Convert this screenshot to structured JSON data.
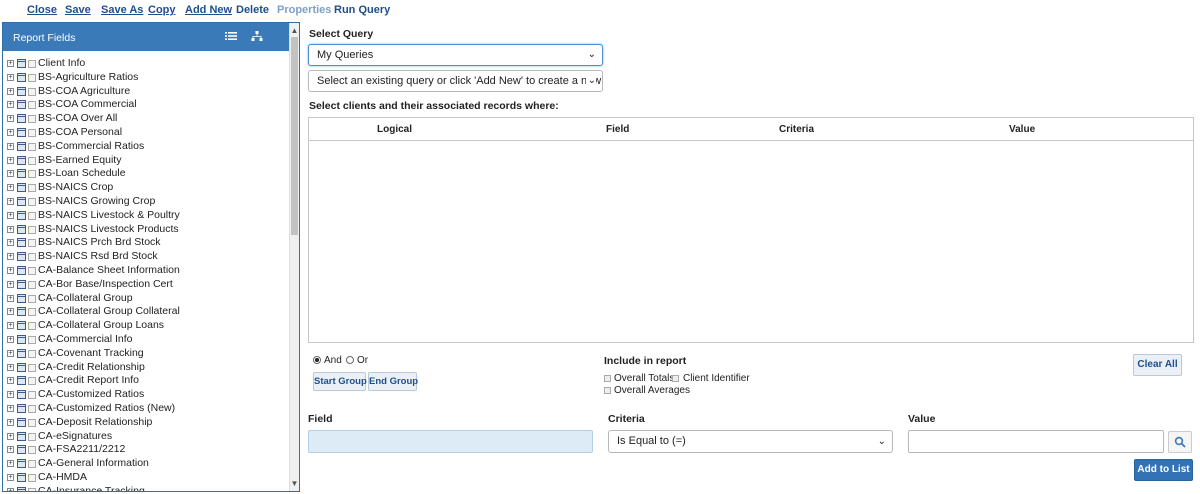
{
  "menu": {
    "close": "Close",
    "save": "Save",
    "save_as": "Save As",
    "copy": "Copy",
    "add_new": "Add New",
    "delete": "Delete",
    "properties": "Properties",
    "run_query": "Run Query"
  },
  "left_panel": {
    "title": "Report Fields",
    "icons": [
      "list-view-icon",
      "hierarchy-view-icon"
    ],
    "tree_items": [
      "Client Info",
      "BS-Agriculture Ratios",
      "BS-COA Agriculture",
      "BS-COA Commercial",
      "BS-COA Over All",
      "BS-COA Personal",
      "BS-Commercial Ratios",
      "BS-Earned Equity",
      "BS-Loan Schedule",
      "BS-NAICS Crop",
      "BS-NAICS Growing Crop",
      "BS-NAICS Livestock & Poultry",
      "BS-NAICS Livestock Products",
      "BS-NAICS Prch Brd Stock",
      "BS-NAICS Rsd Brd Stock",
      "CA-Balance Sheet Information",
      "CA-Bor Base/Inspection Cert",
      "CA-Collateral Group",
      "CA-Collateral Group Collateral",
      "CA-Collateral Group Loans",
      "CA-Commercial Info",
      "CA-Covenant Tracking",
      "CA-Credit Relationship",
      "CA-Credit Report Info",
      "CA-Customized Ratios",
      "CA-Customized Ratios (New)",
      "CA-Deposit Relationship",
      "CA-eSignatures",
      "CA-FSA2211/2212",
      "CA-General Information",
      "CA-HMDA",
      "CA-Insurance Tracking"
    ]
  },
  "query": {
    "select_label": "Select Query",
    "category_value": "My Queries",
    "query_value": "Select an existing query or click 'Add New' to create a new query",
    "criteria_label": "Select clients and their associated records where:"
  },
  "grid": {
    "columns": [
      "Logical",
      "Field",
      "Criteria",
      "Value"
    ]
  },
  "logic": {
    "and": "And",
    "or": "Or",
    "start_group": "Start Group",
    "end_group": "End Group"
  },
  "include": {
    "title": "Include in report",
    "overall_totals": "Overall Totals",
    "client_identifier": "Client Identifier",
    "overall_averages": "Overall Averages",
    "clear_all": "Clear All"
  },
  "entry": {
    "field_label": "Field",
    "criteria_label": "Criteria",
    "value_label": "Value",
    "field_value": "",
    "criteria_value": "Is Equal to (=)",
    "value_value": "",
    "add_to_list": "Add to List"
  }
}
